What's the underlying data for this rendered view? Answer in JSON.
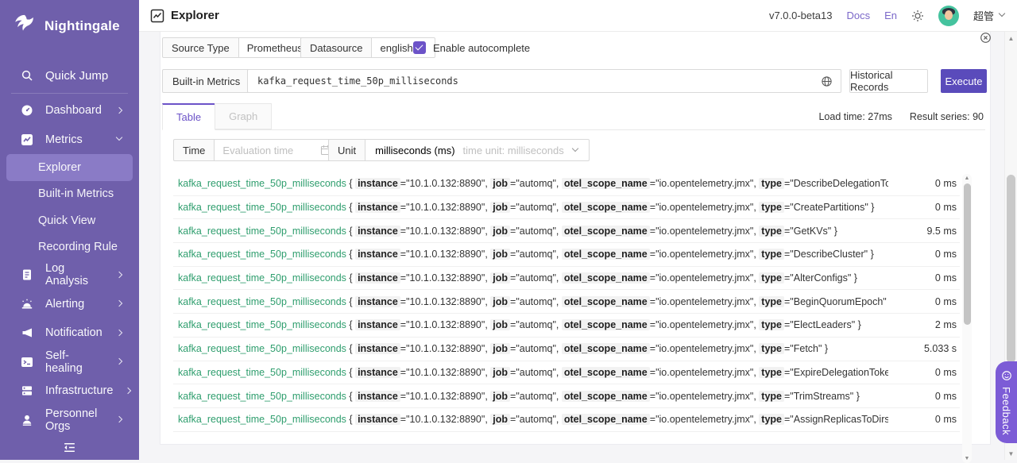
{
  "brand": {
    "name": "Nightingale"
  },
  "header": {
    "title": "Explorer",
    "version": "v7.0.0-beta13",
    "docs_link": "Docs",
    "lang_link": "En",
    "user_name": "超管"
  },
  "sidebar": {
    "quick_jump_label": "Quick Jump",
    "items": [
      {
        "icon": "dashboard-icon",
        "label": "Dashboard",
        "chevron": "right"
      },
      {
        "icon": "metrics-icon",
        "label": "Metrics",
        "chevron": "down",
        "children": [
          {
            "label": "Explorer",
            "selected": true
          },
          {
            "label": "Built-in Metrics",
            "selected": false
          },
          {
            "label": "Quick View",
            "selected": false
          },
          {
            "label": "Recording Rule",
            "selected": false
          }
        ]
      },
      {
        "icon": "log-analysis-icon",
        "label": "Log Analysis",
        "chevron": "right"
      },
      {
        "icon": "alerting-icon",
        "label": "Alerting",
        "chevron": "right"
      },
      {
        "icon": "notification-icon",
        "label": "Notification",
        "chevron": "right"
      },
      {
        "icon": "self-healing-icon",
        "label": "Self-healing",
        "chevron": "right"
      },
      {
        "icon": "infrastructure-icon",
        "label": "Infrastructure",
        "chevron": "right"
      },
      {
        "icon": "personnel-orgs-icon",
        "label": "Personnel Orgs",
        "chevron": "right"
      }
    ]
  },
  "query": {
    "source_type_label": "Source Type",
    "source_type_value": "Prometheus",
    "datasource_label": "Datasource",
    "datasource_value": "english",
    "autocomplete_label": "Enable autocomplete",
    "autocomplete_checked": true,
    "builtin_metrics_label": "Built-in Metrics",
    "metric_query": "kafka_request_time_50p_milliseconds",
    "historical_button": "Historical Records",
    "execute_button": "Execute"
  },
  "results": {
    "tabs": [
      {
        "label": "Table",
        "active": true
      },
      {
        "label": "Graph",
        "active": false
      }
    ],
    "load_time": "Load time: 27ms",
    "result_series": "Result series: 90",
    "time_label": "Time",
    "time_placeholder": "Evaluation time",
    "unit_label": "Unit",
    "unit_value": "milliseconds (ms)",
    "unit_hint": "time unit: milliseconds",
    "metric": "kafka_request_time_50p_milliseconds",
    "labels_common": {
      "instance": "10.1.0.132:8890",
      "job": "automq",
      "otel_scope_name": "io.opentelemetry.jmx"
    },
    "rows": [
      {
        "type": "DescribeDelegationToken",
        "value": "0 ms"
      },
      {
        "type": "CreatePartitions",
        "value": "0 ms"
      },
      {
        "type": "GetKVs",
        "value": "9.5 ms"
      },
      {
        "type": "DescribeCluster",
        "value": "0 ms"
      },
      {
        "type": "AlterConfigs",
        "value": "0 ms"
      },
      {
        "type": "BeginQuorumEpoch",
        "value": "0 ms"
      },
      {
        "type": "ElectLeaders",
        "value": "2 ms"
      },
      {
        "type": "Fetch",
        "value": "5.033 s"
      },
      {
        "type": "ExpireDelegationToken",
        "value": "0 ms"
      },
      {
        "type": "TrimStreams",
        "value": "0 ms"
      },
      {
        "type": "AssignReplicasToDirs",
        "value": "0 ms"
      }
    ]
  },
  "feedback": {
    "label": "Feedback"
  },
  "icons": [
    "nightingale-logo-icon",
    "search-icon",
    "dashboard-icon",
    "metrics-icon",
    "log-analysis-icon",
    "alerting-icon",
    "notification-icon",
    "self-healing-icon",
    "infrastructure-icon",
    "personnel-orgs-icon",
    "menu-fold-icon",
    "line-chart-icon",
    "sun-icon",
    "chevron-down-icon",
    "globe-icon",
    "calendar-icon",
    "close-circle-icon",
    "smiley-icon"
  ]
}
